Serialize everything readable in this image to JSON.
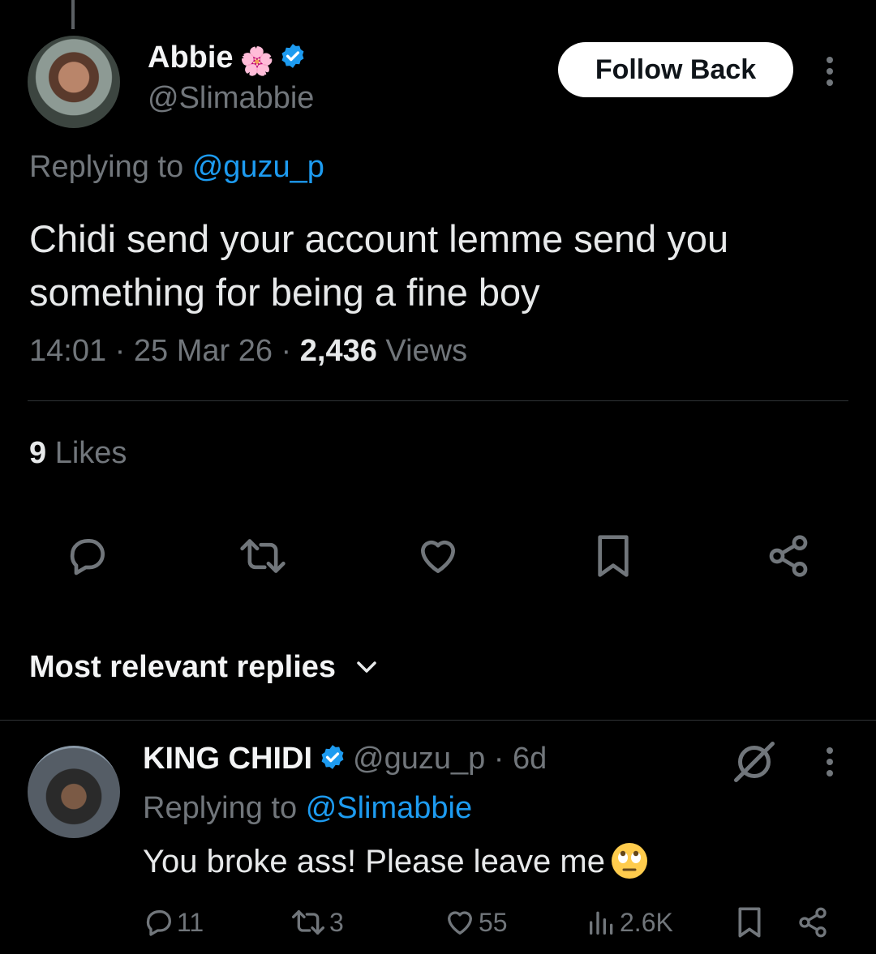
{
  "main_tweet": {
    "author_name": "Abbie",
    "author_handle": "@Slimabbie",
    "follow_button": "Follow Back",
    "replying_prefix": "Replying to",
    "replying_to": "@guzu_p",
    "text": "Chidi send your account lemme send you something for being a fine boy",
    "time": "14:01",
    "date": "25 Mar 26",
    "views_count": "2,436",
    "views_label": "Views",
    "likes_count": "9",
    "likes_label": "Likes"
  },
  "replies_header": {
    "label": "Most relevant replies"
  },
  "reply": {
    "author_name": "KING CHIDI",
    "author_handle": "@guzu_p",
    "age": "6d",
    "replying_prefix": "Replying to",
    "replying_to": "@Slimabbie",
    "text": "You broke ass! Please leave me",
    "stats": {
      "replies": "11",
      "retweets": "3",
      "likes": "55",
      "views": "2.6K"
    }
  },
  "colors": {
    "background": "#000000",
    "text": "#e7e9ea",
    "muted": "#71767b",
    "link": "#1d9bf0",
    "verified": "#1d9bf0"
  },
  "icons": {
    "flower": "cherry-blossom-icon",
    "verified": "verified-badge-icon",
    "more": "more-vertical-icon",
    "reply": "reply-bubble-icon",
    "retweet": "retweet-icon",
    "like": "heart-icon",
    "bookmark": "bookmark-icon",
    "share": "share-icon",
    "grok": "grok-icon",
    "views": "bar-chart-icon",
    "chevron": "chevron-down-icon",
    "emoji": "face-with-rolling-eyes-emoji"
  }
}
